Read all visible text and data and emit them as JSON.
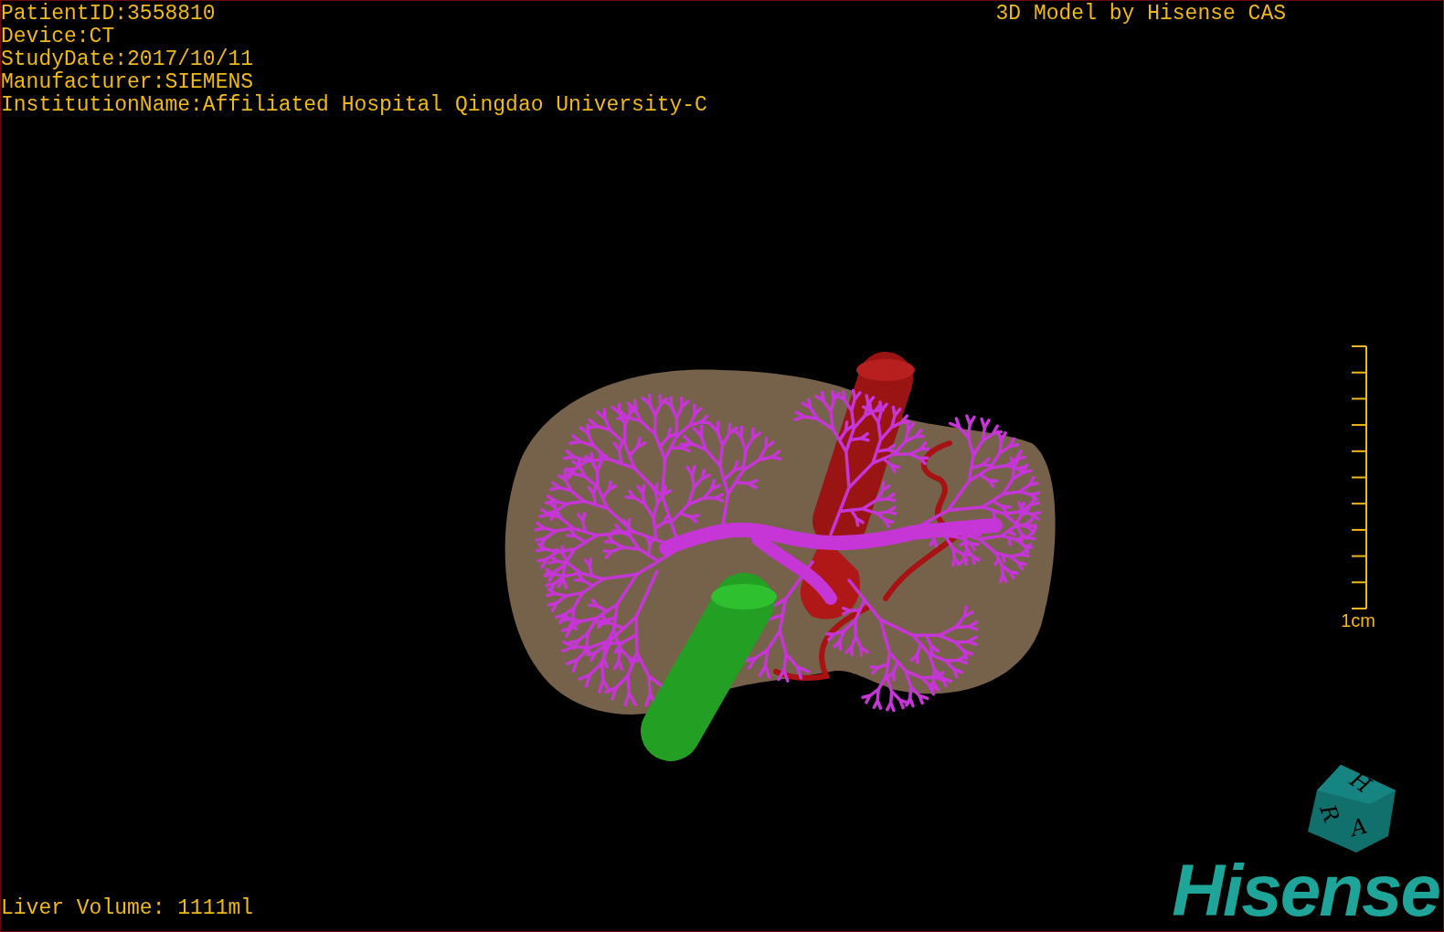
{
  "info_lines": [
    "PatientID:3558810",
    "Device:CT",
    "StudyDate:2017/10/11",
    "Manufacturer:SIEMENS",
    "InstitutionName:Affiliated Hospital Qingdao University-C"
  ],
  "title": "3D Model by Hisense CAS",
  "scale_bar": {
    "label": "1cm"
  },
  "liver_volume": "Liver Volume: 1111ml",
  "orientation_cube": {
    "labels": [
      "H",
      "R",
      "A"
    ]
  },
  "logo": "Hisense"
}
